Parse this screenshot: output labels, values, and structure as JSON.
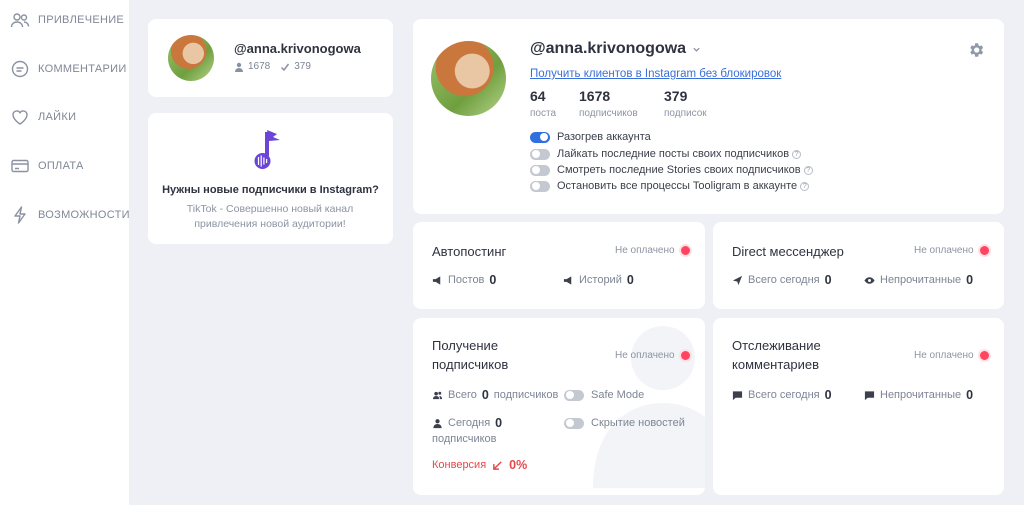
{
  "sidebar": {
    "items": [
      {
        "label": "ПРИВЛЕЧЕНИЕ",
        "icon": "users-icon"
      },
      {
        "label": "КОММЕНТАРИИ",
        "icon": "chat-icon"
      },
      {
        "label": "ЛАЙКИ",
        "icon": "heart-icon"
      },
      {
        "label": "ОПЛАТА",
        "icon": "card-icon"
      },
      {
        "label": "ВОЗМОЖНОСТИ",
        "icon": "lightning-icon"
      }
    ]
  },
  "mini_profile": {
    "handle": "@anna.krivonogowa",
    "followers": "1678",
    "following": "379"
  },
  "promo": {
    "title": "Нужны новые подписчики в Instagram?",
    "description": "TikTok - Совершенно новый канал привлечения новой аудитории!"
  },
  "profile": {
    "handle": "@anna.krivonogowa",
    "link": "Получить клиентов в Instagram без блокировок",
    "stats": [
      {
        "num": "64",
        "cap": "поста"
      },
      {
        "num": "1678",
        "cap": "подписчиков"
      },
      {
        "num": "379",
        "cap": "подписок"
      }
    ],
    "toggles": [
      {
        "label": "Разогрев аккаунта",
        "on": true
      },
      {
        "label": "Лайкать последние посты своих подписчиков",
        "on": false
      },
      {
        "label": "Смотреть последние Stories своих подписчиков",
        "on": false
      },
      {
        "label": "Остановить все процессы Tooligram в аккаунте",
        "on": false
      }
    ]
  },
  "status_not_paid": "Не оплачено",
  "autopost": {
    "title": "Автопостинг",
    "posts_label": "Постов",
    "posts_value": "0",
    "stories_label": "Историй",
    "stories_value": "0"
  },
  "direct": {
    "title": "Direct мессенджер",
    "today_label": "Всего сегодня",
    "today_value": "0",
    "unread_label": "Непрочитанные",
    "unread_value": "0"
  },
  "followers": {
    "title_line1": "Получение",
    "title_line2": "подписчиков",
    "total_label": "Всего",
    "total_value": "0",
    "total_suffix": "подписчиков",
    "today_label": "Сегодня",
    "today_value": "0",
    "today_suffix": "подписчиков",
    "safe_mode": "Safe Mode",
    "hide_news": "Скрытие новостей",
    "conversion_label": "Конверсия",
    "conversion_value": "0%"
  },
  "comments": {
    "title_line1": "Отслеживание",
    "title_line2": "комментариев",
    "today_label": "Всего сегодня",
    "today_value": "0",
    "unread_label": "Непрочитанные",
    "unread_value": "0"
  },
  "colors": {
    "accent": "#2f6fe0",
    "status_red": "#ff4560",
    "promo_purple": "#6b45d8"
  }
}
